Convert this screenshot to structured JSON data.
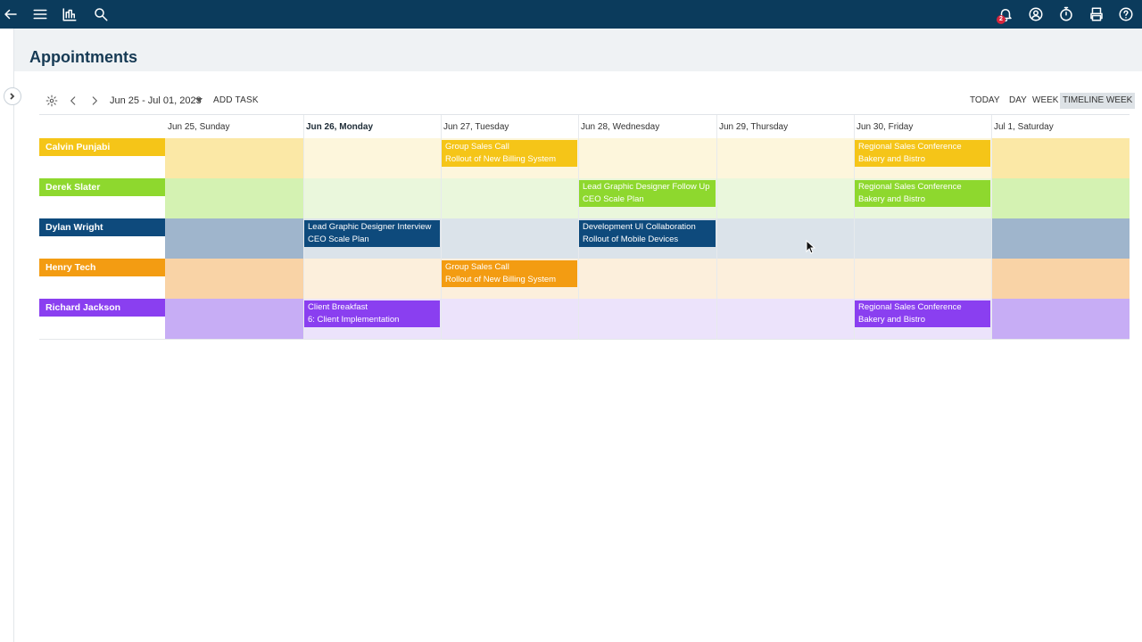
{
  "topbar": {
    "left_icons": [
      "back-arrow-icon",
      "menu-icon",
      "chart-icon",
      "search-icon"
    ],
    "right_icons": [
      "bell-icon",
      "user-circle-icon",
      "timer-icon",
      "printer-icon",
      "help-icon"
    ],
    "notification_count": "2"
  },
  "page": {
    "title": "Appointments"
  },
  "toolbar": {
    "date_range": "Jun 25 - Jul 01, 2023",
    "add_task": "ADD TASK",
    "views": [
      "TODAY",
      "DAY",
      "WEEK",
      "TIMELINE WEEK"
    ],
    "active_view": "TIMELINE WEEK"
  },
  "days": [
    "Jun 25, Sunday",
    "Jun 26, Monday",
    "Jun 27, Tuesday",
    "Jun 28, Wednesday",
    "Jun 29, Thursday",
    "Jun 30, Friday",
    "Jul 1, Saturday"
  ],
  "today_index": 1,
  "resources": [
    {
      "name": "Calvin Punjabi",
      "color": "#f5c518",
      "cell": "#fdf6dc",
      "weekend": "#fbe8a6",
      "events": [
        {
          "day": 2,
          "lines": [
            "Group Sales Call",
            "Rollout of New Billing System"
          ]
        },
        {
          "day": 5,
          "lines": [
            "Regional Sales Conference",
            "Bakery and Bistro"
          ]
        }
      ]
    },
    {
      "name": "Derek Slater",
      "color": "#8ed82e",
      "cell": "#eaf7dc",
      "weekend": "#d4f2b2",
      "events": [
        {
          "day": 3,
          "lines": [
            "Lead Graphic Designer Follow Up",
            "CEO Scale Plan"
          ]
        },
        {
          "day": 5,
          "lines": [
            "Regional Sales Conference",
            "Bakery and Bistro"
          ]
        }
      ]
    },
    {
      "name": "Dylan Wright",
      "color": "#0e4a7c",
      "cell": "#dbe3ea",
      "weekend": "#9fb5cc",
      "events": [
        {
          "day": 1,
          "lines": [
            "Lead Graphic Designer Interview",
            "CEO Scale Plan"
          ]
        },
        {
          "day": 3,
          "lines": [
            "Development UI Collaboration",
            "Rollout of Mobile Devices"
          ]
        }
      ]
    },
    {
      "name": "Henry Tech",
      "color": "#f39c12",
      "cell": "#fcefdc",
      "weekend": "#f9d3a6",
      "events": [
        {
          "day": 2,
          "lines": [
            "Group Sales Call",
            "Rollout of New Billing System"
          ]
        }
      ]
    },
    {
      "name": "Richard Jackson",
      "color": "#8a3ff0",
      "cell": "#ece3fb",
      "weekend": "#c7adf5",
      "events": [
        {
          "day": 1,
          "lines": [
            "Client Breakfast",
            "6: Client Implementation"
          ]
        },
        {
          "day": 5,
          "lines": [
            "Regional Sales Conference",
            "Bakery and Bistro"
          ]
        }
      ]
    }
  ]
}
